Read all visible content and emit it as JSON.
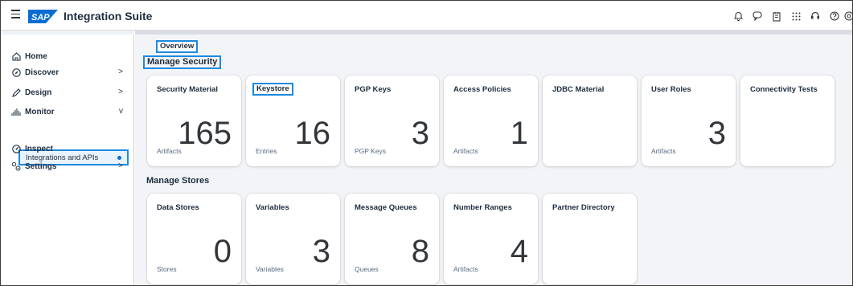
{
  "shell": {
    "logo_text": "SAP",
    "title": "Integration Suite",
    "brand_color": "#0a6ed1",
    "actions": [
      "bell-icon",
      "feedback-icon",
      "notes-icon",
      "app-grid-icon",
      "support-icon",
      "help-icon",
      "settings-icon"
    ]
  },
  "sidebar": {
    "items": [
      {
        "label": "Home",
        "icon": "home-icon",
        "chevron": ""
      },
      {
        "label": "Discover",
        "icon": "discover-icon",
        "chevron": ">"
      },
      {
        "label": "Design",
        "icon": "design-icon",
        "chevron": ">"
      },
      {
        "label": "Monitor",
        "icon": "monitor-icon",
        "chevron": "v"
      },
      {
        "label": "Inspect",
        "icon": "inspect-icon",
        "chevron": ""
      },
      {
        "label": "Settings",
        "icon": "settings-icon",
        "chevron": ">"
      }
    ],
    "sub_item": {
      "label": "Integrations and APIs",
      "highlight_color": "#1c8ae0"
    }
  },
  "main": {
    "tab": "Overview",
    "security": {
      "title": "Manage Security",
      "tiles": [
        {
          "title": "Security Material",
          "value": "165",
          "unit": "Artifacts"
        },
        {
          "title": "Keystore",
          "value": "16",
          "unit": "Entries"
        },
        {
          "title": "PGP Keys",
          "value": "3",
          "unit": "PGP Keys"
        },
        {
          "title": "Access Policies",
          "value": "1",
          "unit": "Artifacts"
        },
        {
          "title": "JDBC Material",
          "value": "",
          "unit": ""
        },
        {
          "title": "User Roles",
          "value": "3",
          "unit": "Artifacts"
        },
        {
          "title": "Connectivity Tests",
          "value": "",
          "unit": ""
        }
      ]
    },
    "stores": {
      "title": "Manage Stores",
      "tiles": [
        {
          "title": "Data Stores",
          "value": "0",
          "unit": "Stores"
        },
        {
          "title": "Variables",
          "value": "3",
          "unit": "Variables"
        },
        {
          "title": "Message Queues",
          "value": "8",
          "unit": "Queues"
        },
        {
          "title": "Number Ranges",
          "value": "4",
          "unit": "Artifacts"
        },
        {
          "title": "Partner Directory",
          "value": "",
          "unit": ""
        }
      ]
    }
  }
}
